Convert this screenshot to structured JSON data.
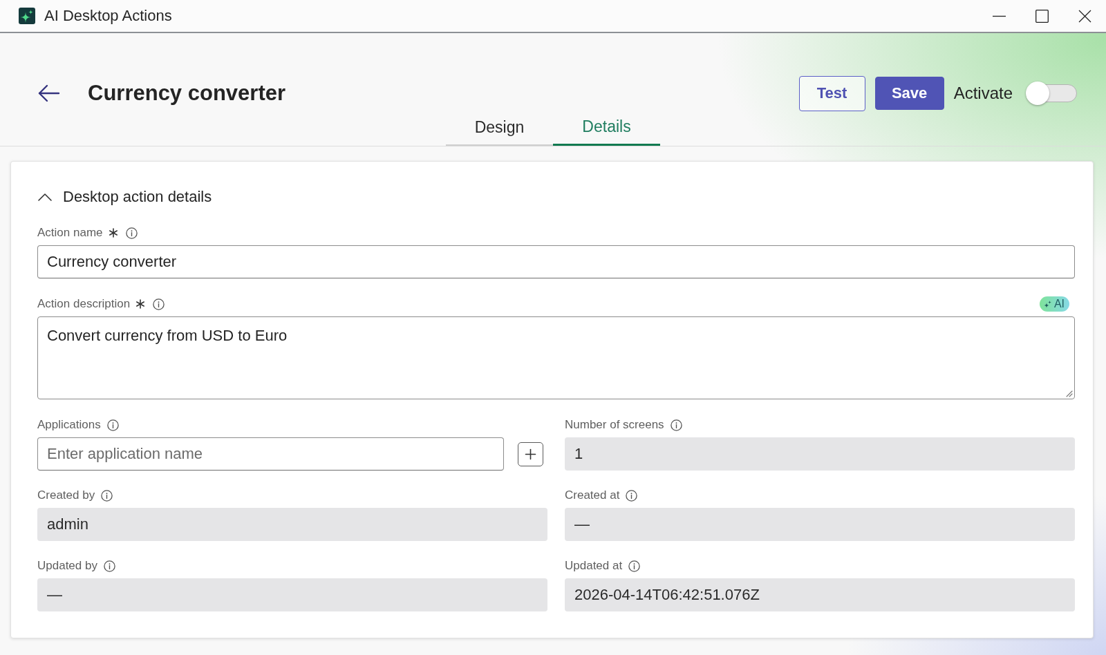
{
  "window": {
    "title": "AI Desktop Actions"
  },
  "header": {
    "title": "Currency converter",
    "buttons": [
      {
        "label": "Test",
        "kind": "outline"
      },
      {
        "label": "Save",
        "kind": "primary"
      }
    ],
    "activate": {
      "label": "Activate",
      "on": false
    }
  },
  "tabs": [
    {
      "label": "Design",
      "selected": false
    },
    {
      "label": "Details",
      "selected": true
    }
  ],
  "section": {
    "title": "Desktop action details",
    "expanded": true,
    "fields": [
      {
        "label": "Action name",
        "required": true,
        "kind": "text",
        "value": "Currency converter"
      },
      {
        "label": "Action description",
        "required": true,
        "kind": "textarea",
        "value": "Convert currency from USD to Euro",
        "badge": "AI"
      }
    ],
    "grid": [
      {
        "label": "Applications",
        "kind": "text",
        "placeholder": "Enter application name",
        "add_button": true
      },
      {
        "label": "Number of screens",
        "kind": "readonly",
        "value": "1"
      },
      {
        "label": "Created by",
        "kind": "readonly",
        "value": "admin"
      },
      {
        "label": "Created at",
        "kind": "readonly",
        "value": "—"
      },
      {
        "label": "Updated by",
        "kind": "readonly",
        "value": "—"
      },
      {
        "label": "Updated at",
        "kind": "readonly",
        "value": "2026-04-14T06:42:51.076Z"
      }
    ]
  }
}
